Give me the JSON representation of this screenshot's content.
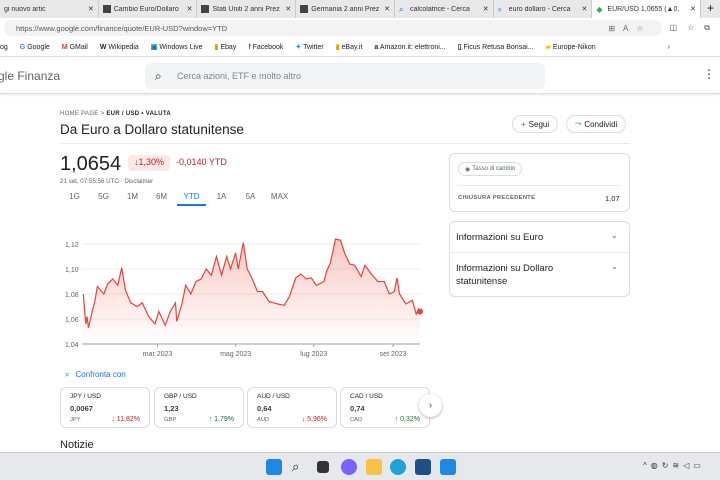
{
  "browser": {
    "tabs": [
      {
        "label": "gi nuovo artic",
        "icon": "page-icon"
      },
      {
        "label": "Cambio Euro/Dollaro",
        "icon": "site-icon"
      },
      {
        "label": "Stati Uniti 2 anni Prez",
        "icon": "investing-icon"
      },
      {
        "label": "Germania 2 anni Prez",
        "icon": "investing-icon"
      },
      {
        "label": "calcolatrice - Cerca",
        "icon": "search-icon"
      },
      {
        "label": "euro dollaro - Cerca",
        "icon": "search-icon"
      },
      {
        "label": "EUR/USD 1,0655 (▲0,",
        "icon": "google-finance-icon",
        "active": true
      }
    ],
    "url": "https://www.google.com/finance/quote/EUR-USD?window=YTD",
    "bookmarks": [
      "og",
      "Google",
      "GMail",
      "Wikipedia",
      "Windows Live",
      "Ebay",
      "Facebook",
      "Twitter",
      "eBay.it",
      "Amazon.it: elettroni...",
      "Ficus Retusa Bonsai...",
      "Europe-Nikon"
    ]
  },
  "header": {
    "logo": "gle Finanza",
    "search_placeholder": "Cerca azioni, ETF e molto altro"
  },
  "breadcrumb": {
    "home": "HOME PAGE",
    "current": "EUR / USD • VALUTA"
  },
  "title": "Da Euro a Dollaro statunitense",
  "actions": {
    "follow": "Segui",
    "share": "Condividi"
  },
  "quote": {
    "price": "1,0654",
    "change_pct": "↓1,30%",
    "change_abs": "-0,0140 YTD",
    "timestamp": "21 set, 07:55:56 UTC · Disclaimer"
  },
  "ranges": [
    "1G",
    "5G",
    "1M",
    "6M",
    "YTD",
    "1A",
    "5A",
    "MAX"
  ],
  "selected_range": "YTD",
  "chart_data": {
    "type": "area",
    "ylim": [
      1.04,
      1.125
    ],
    "yticks": [
      "1,12",
      "1,10",
      "1,08",
      "1,06",
      "1,04"
    ],
    "ytick_values": [
      1.12,
      1.1,
      1.08,
      1.06,
      1.04
    ],
    "xticks": [
      {
        "label": "mar 2023",
        "date": "2023-03-01"
      },
      {
        "label": "mag 2023",
        "date": "2023-05-01"
      },
      {
        "label": "lug 2023",
        "date": "2023-07-01"
      },
      {
        "label": "set 2023",
        "date": "2023-09-01"
      }
    ],
    "xlim": [
      "2023-01-01",
      "2023-09-22"
    ],
    "color": "#ea4335",
    "points": [
      [
        "2023-01-02",
        1.08
      ],
      [
        "2023-01-04",
        1.056
      ],
      [
        "2023-01-05",
        1.062
      ],
      [
        "2023-01-06",
        1.053
      ],
      [
        "2023-01-09",
        1.066
      ],
      [
        "2023-01-11",
        1.074
      ],
      [
        "2023-01-13",
        1.086
      ],
      [
        "2023-01-18",
        1.08
      ],
      [
        "2023-01-21",
        1.088
      ],
      [
        "2023-01-25",
        1.092
      ],
      [
        "2023-01-29",
        1.087
      ],
      [
        "2023-02-01",
        1.101
      ],
      [
        "2023-02-04",
        1.083
      ],
      [
        "2023-02-08",
        1.073
      ],
      [
        "2023-02-13",
        1.07
      ],
      [
        "2023-02-17",
        1.073
      ],
      [
        "2023-02-22",
        1.062
      ],
      [
        "2023-02-27",
        1.056
      ],
      [
        "2023-03-02",
        1.066
      ],
      [
        "2023-03-07",
        1.055
      ],
      [
        "2023-03-11",
        1.066
      ],
      [
        "2023-03-15",
        1.073
      ],
      [
        "2023-03-16",
        1.058
      ],
      [
        "2023-03-20",
        1.072
      ],
      [
        "2023-03-23",
        1.087
      ],
      [
        "2023-03-27",
        1.08
      ],
      [
        "2023-03-31",
        1.09
      ],
      [
        "2023-04-04",
        1.092
      ],
      [
        "2023-04-08",
        1.1
      ],
      [
        "2023-04-12",
        1.095
      ],
      [
        "2023-04-16",
        1.11
      ],
      [
        "2023-04-20",
        1.095
      ],
      [
        "2023-04-24",
        1.11
      ],
      [
        "2023-04-27",
        1.1
      ],
      [
        "2023-05-01",
        1.113
      ],
      [
        "2023-05-03",
        1.1
      ],
      [
        "2023-05-07",
        1.121
      ],
      [
        "2023-05-10",
        1.1
      ],
      [
        "2023-05-14",
        1.092
      ],
      [
        "2023-05-18",
        1.082
      ],
      [
        "2023-05-22",
        1.082
      ],
      [
        "2023-05-27",
        1.074
      ],
      [
        "2023-06-03",
        1.072
      ],
      [
        "2023-06-08",
        1.071
      ],
      [
        "2023-06-12",
        1.078
      ],
      [
        "2023-06-17",
        1.093
      ],
      [
        "2023-06-21",
        1.096
      ],
      [
        "2023-06-25",
        1.092
      ],
      [
        "2023-06-29",
        1.093
      ],
      [
        "2023-07-03",
        1.087
      ],
      [
        "2023-07-09",
        1.09
      ],
      [
        "2023-07-11",
        1.098
      ],
      [
        "2023-07-14",
        1.105
      ],
      [
        "2023-07-18",
        1.124
      ],
      [
        "2023-07-22",
        1.123
      ],
      [
        "2023-07-25",
        1.113
      ],
      [
        "2023-07-29",
        1.104
      ],
      [
        "2023-08-02",
        1.103
      ],
      [
        "2023-08-07",
        1.094
      ],
      [
        "2023-08-10",
        1.103
      ],
      [
        "2023-08-15",
        1.096
      ],
      [
        "2023-08-20",
        1.09
      ],
      [
        "2023-08-25",
        1.09
      ],
      [
        "2023-08-29",
        1.08
      ],
      [
        "2023-09-02",
        1.082
      ],
      [
        "2023-09-04",
        1.093
      ],
      [
        "2023-09-06",
        1.08
      ],
      [
        "2023-09-11",
        1.072
      ],
      [
        "2023-09-16",
        1.075
      ],
      [
        "2023-09-19",
        1.064
      ],
      [
        "2023-09-21",
        1.068
      ],
      [
        "2023-09-22",
        1.066
      ]
    ]
  },
  "stats": {
    "badge": "Tasso di cambio",
    "prev_close_label": "CHIUSURA PRECEDENTE",
    "prev_close": "1,07"
  },
  "about": [
    "Informazioni su Euro",
    "Informazioni su Dollaro statunitense"
  ],
  "compare": {
    "label": "Confronta con",
    "items": [
      {
        "pair": "JPY / USD",
        "value": "0,0067",
        "code": "JPY",
        "change": "↓ 11,82%",
        "dir": "down"
      },
      {
        "pair": "GBP / USD",
        "value": "1,23",
        "code": "GBP",
        "change": "↑ 1,79%",
        "dir": "up"
      },
      {
        "pair": "AUD / USD",
        "value": "0,64",
        "code": "AUD",
        "change": "↓ 5,96%",
        "dir": "down"
      },
      {
        "pair": "CAD / USD",
        "value": "0,74",
        "code": "CAD",
        "change": "↑ 0,32%",
        "dir": "up"
      }
    ]
  },
  "news_heading": "Notizie"
}
